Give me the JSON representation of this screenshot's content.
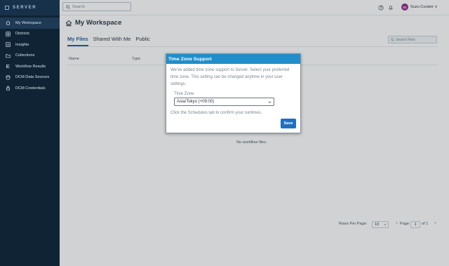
{
  "brand": {
    "name": "SERVER"
  },
  "sidebar": {
    "items": [
      {
        "label": "My Workspace",
        "icon": "home-icon",
        "active": true
      },
      {
        "label": "Districts",
        "icon": "districts-icon"
      },
      {
        "label": "Insights",
        "icon": "insights-icon"
      },
      {
        "label": "Collections",
        "icon": "folder-icon"
      },
      {
        "label": "Workflow Results",
        "icon": "workflow-results-icon"
      },
      {
        "label": "DCM Data Sources",
        "icon": "database-icon"
      },
      {
        "label": "DCM Credentials",
        "icon": "lock-icon"
      }
    ]
  },
  "topbar": {
    "search_placeholder": "Search",
    "user_initials": "SC",
    "user_name": "Suzu Curator ∨"
  },
  "main": {
    "title": "My Workspace",
    "tabs": [
      {
        "label": "My Files"
      },
      {
        "label": "Shared With Me"
      },
      {
        "label": "Public"
      }
    ],
    "file_search_placeholder": "Search Files",
    "columns": [
      "Name",
      "Type"
    ],
    "empty_message": "No workflow files.",
    "pagination": {
      "rows_per_page_label": "Rows Per Page:",
      "rows_per_page": "10",
      "page_label": "Page",
      "page": "1",
      "of_label": "of 1"
    }
  },
  "modal": {
    "title": "Time Zone Support",
    "body": "We've added time zone support to Server. Select your preferred time zone. This setting can be changed anytime in your user settings.",
    "timezone_label": "Time Zone",
    "timezone_value": "Asia/Tokyo (+09:00)",
    "hint": "Click the Schedules tab to confirm your runtimes.",
    "save_label": "Save"
  },
  "colors": {
    "sidebar_bg": "#0f2335",
    "accent": "#1f5ea8",
    "modal_header": "#1f8ecb",
    "save_button": "#1f6fc3"
  }
}
